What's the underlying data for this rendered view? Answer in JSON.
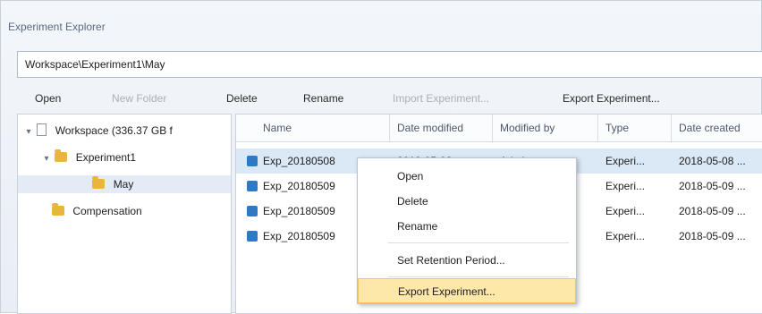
{
  "window": {
    "title": "Experiment Explorer"
  },
  "address_bar": {
    "path": "Workspace\\Experiment1\\May"
  },
  "toolbar": {
    "items": [
      {
        "label": "Open",
        "enabled": true
      },
      {
        "label": "New Folder",
        "enabled": false
      },
      {
        "label": "Delete",
        "enabled": true
      },
      {
        "label": "Rename",
        "enabled": true
      },
      {
        "label": "Import Experiment...",
        "enabled": false
      },
      {
        "label": "Export Experiment...",
        "enabled": true
      }
    ]
  },
  "tree": {
    "root": {
      "label": "Workspace (336.37 GB f",
      "expanded": true
    },
    "items": [
      {
        "label": "Experiment1",
        "expanded": true
      },
      {
        "label": "May",
        "selected": true
      },
      {
        "label": "Compensation"
      }
    ]
  },
  "list": {
    "columns": [
      "Name",
      "Date modified",
      "Modified by",
      "Type",
      "Date created"
    ],
    "rows": [
      {
        "name": "Exp_20180508",
        "date_modified": "2018-05-08 ...",
        "modified_by": "Admin",
        "type": "Experi...",
        "date_created": "2018-05-08 ...",
        "selected": true
      },
      {
        "name": "Exp_20180509",
        "date_modified": "",
        "modified_by": "",
        "type": "Experi...",
        "date_created": "2018-05-09 ..."
      },
      {
        "name": "Exp_20180509",
        "date_modified": "",
        "modified_by": "",
        "type": "Experi...",
        "date_created": "2018-05-09 ..."
      },
      {
        "name": "Exp_20180509",
        "date_modified": "",
        "modified_by": "",
        "type": "Experi...",
        "date_created": "2018-05-09 ..."
      }
    ]
  },
  "context_menu": {
    "items": [
      {
        "label": "Open"
      },
      {
        "label": "Delete"
      },
      {
        "label": "Rename"
      },
      {
        "label": "Set Retention Period..."
      },
      {
        "label": "Export Experiment...",
        "highlighted": true
      }
    ]
  },
  "colors": {
    "accent": "#2f78c4",
    "highlight": "#fde7a9",
    "selection": "#dbe8f6"
  }
}
